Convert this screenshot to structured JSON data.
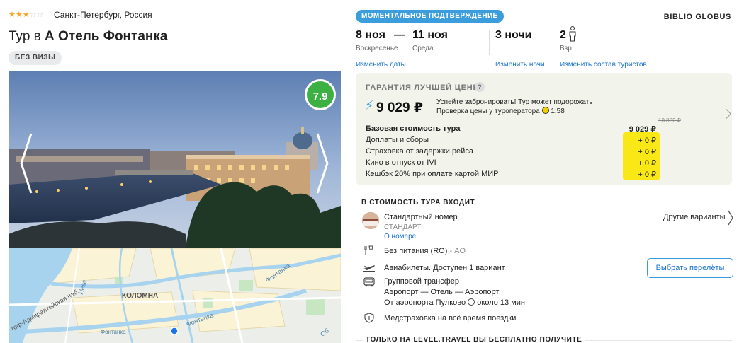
{
  "hotel": {
    "stars": "★★★☆☆",
    "location": "Санкт-Петербург, Россия",
    "title_prefix": "Тур в",
    "title_name": "А Отель Фонтанка",
    "visa_badge": "БЕЗ ВИЗЫ",
    "rating": "7.9"
  },
  "map": {
    "district": "КОЛОМНА",
    "street_neva": "Нева",
    "street_fontanka1": "Фонтанка",
    "street_fontanka2": "Фонтанка",
    "street_fontanka3": "Фонтанка",
    "street_embankment": "гоф-Адмиралтейская наб.",
    "street_ob": "Об"
  },
  "booking": {
    "instant_badge": "МОМЕНТАЛЬНОЕ ПОДТВЕРЖДЕНИЕ",
    "operator": "BIBLIO GLOBUS",
    "date_from": "8 ноя",
    "date_dash": "—",
    "date_to": "11 ноя",
    "day_from": "Воскресенье",
    "day_to": "Среда",
    "nights": "3 ночи",
    "guests_count": "2",
    "guests_label": "Взр.",
    "change_dates": "Изменить даты",
    "change_nights": "Изменить ночи",
    "change_guests": "Изменить состав туристов"
  },
  "price": {
    "guarantee": "ГАРАНТИЯ ЛУЧШЕЙ ЦЕНЫ",
    "question": "?",
    "amount": "9 029 ₽",
    "hurry_line1": "Успейте забронировать! Тур может подорожать",
    "hurry_line2": "Проверка цены у туроператора",
    "hurry_timer": "1:58",
    "old_price": "13 882 ₽",
    "rows": [
      {
        "label": "Базовая стоимость тура",
        "value": "9 029 ₽"
      },
      {
        "label": "Доплаты и сборы",
        "value": "+ 0 ₽"
      },
      {
        "label": "Страховка от задержки рейса",
        "value": "+ 0 ₽"
      },
      {
        "label": "Кино в отпуск от IVI",
        "value": "+ 0 ₽"
      },
      {
        "label": "Кешбэк 20% при оплате картой МИР",
        "value": "+ 0 ₽"
      }
    ]
  },
  "includes": {
    "title": "В СТОИМОСТЬ ТУРА ВХОДИТ",
    "room_name": "Стандартный номер",
    "room_type": "СТАНДАРТ",
    "room_link": "О номере",
    "other_options": "Другие варианты",
    "meal": "Без питания (RO)",
    "meal_code": "- AO",
    "flights": "Авиабилеты. Доступен 1 вариант",
    "choose_flights": "Выбрать перелёты",
    "transfer_title": "Групповой трансфер",
    "transfer_route": "Аэропорт — Отель — Аэропорт",
    "transfer_from": "От аэропорта Пулково",
    "transfer_time": "около 13 мин",
    "insurance": "Медстраховка на всё время поездки"
  },
  "free": {
    "title": "ТОЛЬКО НА LEVEL.TRAVEL ВЫ БЕСПЛАТНО ПОЛУЧИТЕ"
  }
}
